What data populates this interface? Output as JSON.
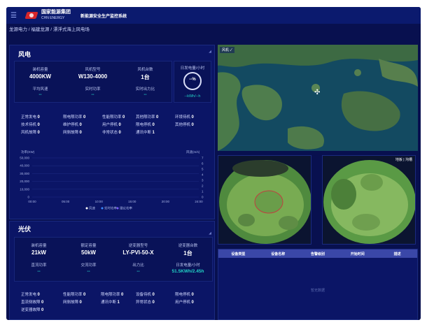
{
  "header": {
    "menu_icon": "menu-icon",
    "brand_cn": "国家能源集团",
    "brand_en": "CHN ENERGY",
    "system_title": "新能源安全生产监控系统"
  },
  "breadcrumb": "龙源电力 / 福建龙源 / 漂浮式海上风电场",
  "wind": {
    "title": "风电",
    "stats": [
      {
        "label": "装机容量",
        "value": "4000KW"
      },
      {
        "label": "风机型号",
        "value": "W130-4000"
      },
      {
        "label": "风机台数",
        "value": "1台"
      }
    ],
    "stats2": [
      {
        "label": "平均风速",
        "value": "--"
      },
      {
        "label": "实时功率",
        "value": "--"
      },
      {
        "label": "实时出力比",
        "value": "--"
      }
    ],
    "gauge": {
      "label": "日发电量/小时",
      "value": "--%",
      "sub": "--kWh/--h"
    },
    "status": [
      [
        {
          "name": "正常发电",
          "count": "0"
        },
        {
          "name": "限电限功率",
          "count": "0"
        },
        {
          "name": "性能限功率",
          "count": "0"
        },
        {
          "name": "其他限功率",
          "count": "0"
        },
        {
          "name": "环境待机",
          "count": "0"
        }
      ],
      [
        {
          "name": "技术待机",
          "count": "0"
        },
        {
          "name": "维护停机",
          "count": "0"
        },
        {
          "name": "用户停机",
          "count": "0"
        },
        {
          "name": "限电停机",
          "count": "0"
        },
        {
          "name": "其他停机",
          "count": "0"
        }
      ],
      [
        {
          "name": "风机故障",
          "count": "0"
        },
        {
          "name": "网侧故障",
          "count": "0"
        },
        {
          "name": "非常状态",
          "count": "0"
        },
        {
          "name": "通讯中断",
          "count": "1"
        }
      ]
    ]
  },
  "chart_data": {
    "type": "line",
    "ylabel_left": "功率(KW)",
    "ylabel_right": "风速(m/s)",
    "left_ticks": [
      "50,000",
      "40,000",
      "30,000",
      "20,000",
      "10,000",
      "0"
    ],
    "right_ticks": [
      "7",
      "6",
      "5",
      "4",
      "3",
      "2",
      "1",
      "0"
    ],
    "x_ticks": [
      "00:00",
      "05:00",
      "10:00",
      "15:00",
      "20:00",
      "24:00"
    ],
    "legend": [
      "风速",
      "实时功率",
      "理论功率"
    ],
    "series_colors": [
      "#ffffff",
      "#3d8bff",
      "#7b5cff"
    ]
  },
  "solar": {
    "title": "光伏",
    "stats": [
      {
        "label": "装机容量",
        "value": "21kW"
      },
      {
        "label": "额定容量",
        "value": "50kW"
      },
      {
        "label": "逆变器型号",
        "value": "LY-PVI-50-X"
      },
      {
        "label": "逆变器台数",
        "value": "1台"
      }
    ],
    "stats2": [
      {
        "label": "直流功率",
        "value": "--"
      },
      {
        "label": "交流功率",
        "value": "--"
      },
      {
        "label": "出力比",
        "value": "--"
      },
      {
        "label": "日发电量/小时",
        "value": "51.5KWh/2.45h"
      }
    ],
    "status": [
      [
        {
          "name": "正常发电",
          "count": "0"
        },
        {
          "name": "性能限功率",
          "count": "0"
        },
        {
          "name": "限电限功率",
          "count": "0"
        },
        {
          "name": "设备待机",
          "count": "0"
        },
        {
          "name": "限电停机",
          "count": "0"
        }
      ],
      [
        {
          "name": "直流侧故障",
          "count": "0"
        },
        {
          "name": "网侧故障",
          "count": "0"
        },
        {
          "name": "通讯中断",
          "count": "1"
        },
        {
          "name": "异常状态",
          "count": "0"
        },
        {
          "name": "用户停机",
          "count": "0"
        }
      ],
      [
        {
          "name": "逆变器故障",
          "count": "0"
        }
      ]
    ]
  },
  "map": {
    "nav_label": "风机"
  },
  "video": {
    "controls": "地板 | 沟槽"
  },
  "table": {
    "headers": [
      "设备类型",
      "设备名称",
      "告警级别",
      "开始时间",
      "描述"
    ],
    "empty": "暂无数据"
  }
}
